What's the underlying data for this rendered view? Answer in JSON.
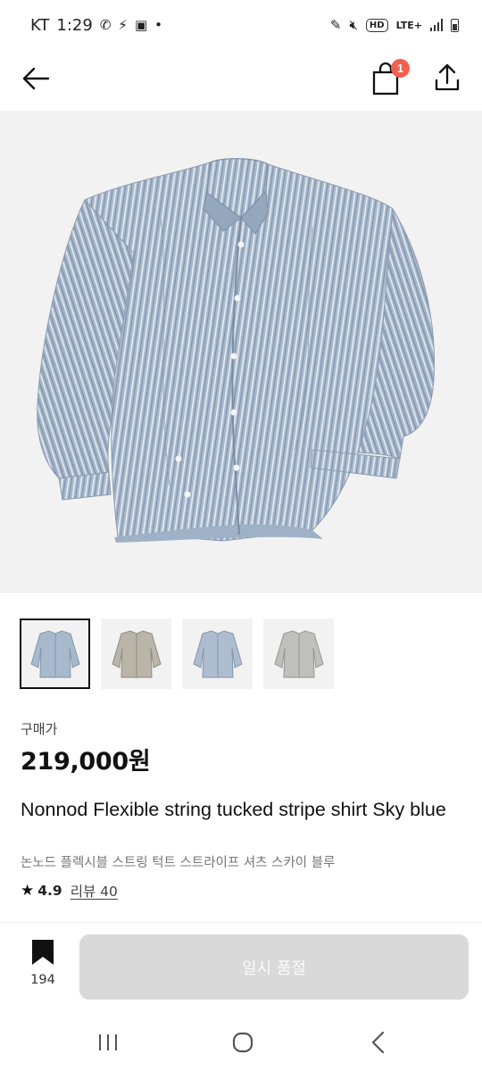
{
  "status_bar": {
    "carrier": "KT",
    "time": "1:29",
    "network": "LTE+",
    "hd_label": "HD"
  },
  "header": {
    "cart_badge": "1"
  },
  "product": {
    "gallery": {
      "main_image_icon": "striped-shirt-photo",
      "thumbnail_count": 4,
      "selected_thumbnail": 1
    },
    "price_label": "구매가",
    "price": "219,000원",
    "title_en": "Nonnod Flexible string tucked stripe shirt Sky blue",
    "title_ko": "논노드 플렉시블 스트링 턱트 스트라이프 셔츠 스카이 블루",
    "rating": "4.9",
    "review_link": "리뷰 40"
  },
  "action_bar": {
    "bookmark_count": "194",
    "sold_out_label": "일시 품절"
  },
  "colors": {
    "badge": "#f0604f",
    "disabled_button": "#d9d9d9",
    "image_bg": "#f2f2f2"
  }
}
